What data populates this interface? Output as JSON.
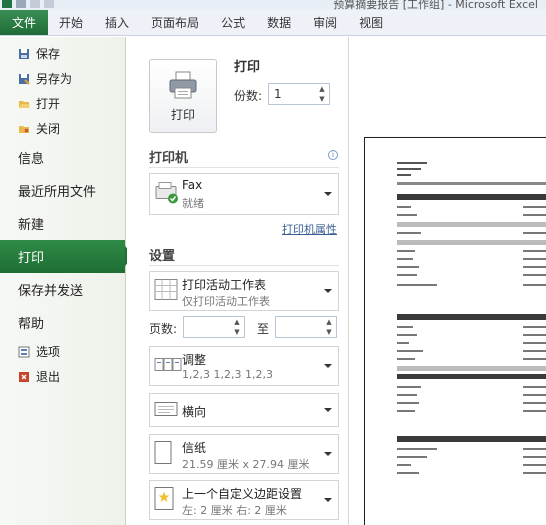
{
  "window": {
    "title": "预算摘要报告 [工作组] - Microsoft Excel"
  },
  "ribbon": {
    "tabs": [
      {
        "label": "文件"
      },
      {
        "label": "开始"
      },
      {
        "label": "插入"
      },
      {
        "label": "页面布局"
      },
      {
        "label": "公式"
      },
      {
        "label": "数据"
      },
      {
        "label": "审阅"
      },
      {
        "label": "视图"
      }
    ]
  },
  "nav": {
    "save": "保存",
    "save_as": "另存为",
    "open": "打开",
    "close": "关闭",
    "info": "信息",
    "recent": "最近所用文件",
    "new": "新建",
    "print": "打印",
    "save_send": "保存并发送",
    "help": "帮助",
    "options": "选项",
    "exit": "退出"
  },
  "print": {
    "button_label": "打印",
    "heading": "打印",
    "copies_label": "份数:",
    "copies_value": "1"
  },
  "printer": {
    "heading": "打印机",
    "name": "Fax",
    "status": "就绪",
    "properties_link": "打印机属性"
  },
  "settings": {
    "heading": "设置",
    "scope_main": "打印活动工作表",
    "scope_sub": "仅打印活动工作表",
    "pages_label": "页数:",
    "to_label": "至",
    "collate_main": "调整",
    "collate_sub": "1,2,3    1,2,3    1,2,3",
    "orientation": "横向",
    "paper_main": "信纸",
    "paper_sub": "21.59 厘米 x 27.94 厘米",
    "margins_main": "上一个自定义边距设置",
    "margins_sub": "左: 2 厘米    右: 2 厘米"
  },
  "colors": {
    "file_tab": "#217346",
    "active_nav": "#2f8a47",
    "link": "#3a5f92"
  }
}
